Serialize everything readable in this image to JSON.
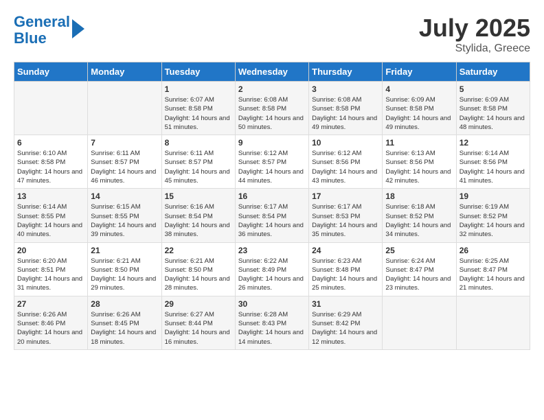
{
  "header": {
    "logo_line1": "General",
    "logo_line2": "Blue",
    "month": "July 2025",
    "location": "Stylida, Greece"
  },
  "days_of_week": [
    "Sunday",
    "Monday",
    "Tuesday",
    "Wednesday",
    "Thursday",
    "Friday",
    "Saturday"
  ],
  "weeks": [
    [
      {
        "day": "",
        "info": ""
      },
      {
        "day": "",
        "info": ""
      },
      {
        "day": "1",
        "info": "Sunrise: 6:07 AM\nSunset: 8:58 PM\nDaylight: 14 hours and 51 minutes."
      },
      {
        "day": "2",
        "info": "Sunrise: 6:08 AM\nSunset: 8:58 PM\nDaylight: 14 hours and 50 minutes."
      },
      {
        "day": "3",
        "info": "Sunrise: 6:08 AM\nSunset: 8:58 PM\nDaylight: 14 hours and 49 minutes."
      },
      {
        "day": "4",
        "info": "Sunrise: 6:09 AM\nSunset: 8:58 PM\nDaylight: 14 hours and 49 minutes."
      },
      {
        "day": "5",
        "info": "Sunrise: 6:09 AM\nSunset: 8:58 PM\nDaylight: 14 hours and 48 minutes."
      }
    ],
    [
      {
        "day": "6",
        "info": "Sunrise: 6:10 AM\nSunset: 8:58 PM\nDaylight: 14 hours and 47 minutes."
      },
      {
        "day": "7",
        "info": "Sunrise: 6:11 AM\nSunset: 8:57 PM\nDaylight: 14 hours and 46 minutes."
      },
      {
        "day": "8",
        "info": "Sunrise: 6:11 AM\nSunset: 8:57 PM\nDaylight: 14 hours and 45 minutes."
      },
      {
        "day": "9",
        "info": "Sunrise: 6:12 AM\nSunset: 8:57 PM\nDaylight: 14 hours and 44 minutes."
      },
      {
        "day": "10",
        "info": "Sunrise: 6:12 AM\nSunset: 8:56 PM\nDaylight: 14 hours and 43 minutes."
      },
      {
        "day": "11",
        "info": "Sunrise: 6:13 AM\nSunset: 8:56 PM\nDaylight: 14 hours and 42 minutes."
      },
      {
        "day": "12",
        "info": "Sunrise: 6:14 AM\nSunset: 8:56 PM\nDaylight: 14 hours and 41 minutes."
      }
    ],
    [
      {
        "day": "13",
        "info": "Sunrise: 6:14 AM\nSunset: 8:55 PM\nDaylight: 14 hours and 40 minutes."
      },
      {
        "day": "14",
        "info": "Sunrise: 6:15 AM\nSunset: 8:55 PM\nDaylight: 14 hours and 39 minutes."
      },
      {
        "day": "15",
        "info": "Sunrise: 6:16 AM\nSunset: 8:54 PM\nDaylight: 14 hours and 38 minutes."
      },
      {
        "day": "16",
        "info": "Sunrise: 6:17 AM\nSunset: 8:54 PM\nDaylight: 14 hours and 36 minutes."
      },
      {
        "day": "17",
        "info": "Sunrise: 6:17 AM\nSunset: 8:53 PM\nDaylight: 14 hours and 35 minutes."
      },
      {
        "day": "18",
        "info": "Sunrise: 6:18 AM\nSunset: 8:52 PM\nDaylight: 14 hours and 34 minutes."
      },
      {
        "day": "19",
        "info": "Sunrise: 6:19 AM\nSunset: 8:52 PM\nDaylight: 14 hours and 32 minutes."
      }
    ],
    [
      {
        "day": "20",
        "info": "Sunrise: 6:20 AM\nSunset: 8:51 PM\nDaylight: 14 hours and 31 minutes."
      },
      {
        "day": "21",
        "info": "Sunrise: 6:21 AM\nSunset: 8:50 PM\nDaylight: 14 hours and 29 minutes."
      },
      {
        "day": "22",
        "info": "Sunrise: 6:21 AM\nSunset: 8:50 PM\nDaylight: 14 hours and 28 minutes."
      },
      {
        "day": "23",
        "info": "Sunrise: 6:22 AM\nSunset: 8:49 PM\nDaylight: 14 hours and 26 minutes."
      },
      {
        "day": "24",
        "info": "Sunrise: 6:23 AM\nSunset: 8:48 PM\nDaylight: 14 hours and 25 minutes."
      },
      {
        "day": "25",
        "info": "Sunrise: 6:24 AM\nSunset: 8:47 PM\nDaylight: 14 hours and 23 minutes."
      },
      {
        "day": "26",
        "info": "Sunrise: 6:25 AM\nSunset: 8:47 PM\nDaylight: 14 hours and 21 minutes."
      }
    ],
    [
      {
        "day": "27",
        "info": "Sunrise: 6:26 AM\nSunset: 8:46 PM\nDaylight: 14 hours and 20 minutes."
      },
      {
        "day": "28",
        "info": "Sunrise: 6:26 AM\nSunset: 8:45 PM\nDaylight: 14 hours and 18 minutes."
      },
      {
        "day": "29",
        "info": "Sunrise: 6:27 AM\nSunset: 8:44 PM\nDaylight: 14 hours and 16 minutes."
      },
      {
        "day": "30",
        "info": "Sunrise: 6:28 AM\nSunset: 8:43 PM\nDaylight: 14 hours and 14 minutes."
      },
      {
        "day": "31",
        "info": "Sunrise: 6:29 AM\nSunset: 8:42 PM\nDaylight: 14 hours and 12 minutes."
      },
      {
        "day": "",
        "info": ""
      },
      {
        "day": "",
        "info": ""
      }
    ]
  ]
}
